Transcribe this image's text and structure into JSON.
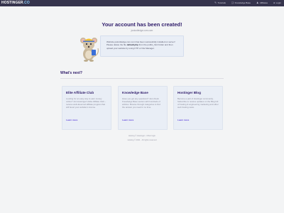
{
  "topbar": {
    "logo_main": "HOSTINGER",
    "logo_tld": ".CO",
    "nav": [
      {
        "icon": "tutorials-icon",
        "glyph": "✎",
        "label": "Tutorials"
      },
      {
        "icon": "knowledge-base-icon",
        "glyph": "❏",
        "label": "Knowledge Base"
      },
      {
        "icon": "affiliates-icon",
        "glyph": "♟",
        "label": "Affiliates"
      },
      {
        "icon": "login-icon",
        "glyph": "●",
        "label": "Login"
      }
    ]
  },
  "hero": {
    "title": "Your account has been created!",
    "subtitle": "justcolledge.com.com",
    "info_part1": "Website justcolledge.com.com has been successfully installed on server! Please delete the file ",
    "info_file": "default.php",
    "info_part2": " from the public_html folder and then upload your website by using FTP or File Manager."
  },
  "section": {
    "heading": "What's next?"
  },
  "cards": [
    {
      "title": "Elite Affiliate Club",
      "text": "Looking for an easy way to earn money online? Join Hostinger's Elite Affiliate Club – receive well-deserved affiliate program that will boost your website's income.",
      "link": "Learn more"
    },
    {
      "title": "Knowledge Base",
      "text": "Have you got any questions? Just check Knowledge Base section with hundreds of articles. Browse through categories to find the answer you need in no time.",
      "link": "Learn more"
    },
    {
      "title": "Hostinger Blog",
      "text": "Become a part of Hostinger community. Subscribe to receive updates on the Blog full of hosting & engineering marketing and other web hosting news.",
      "link": "Learn more"
    }
  ],
  "footer": {
    "line1": "Hosting © Hostinger • Other login",
    "line2": "Hosting © 2021 · All rights reserved"
  },
  "colors": {
    "topbar": "#36344d",
    "accent": "#2f1c6a",
    "link": "#5b3fd9",
    "card_bg": "#e9eef6"
  }
}
